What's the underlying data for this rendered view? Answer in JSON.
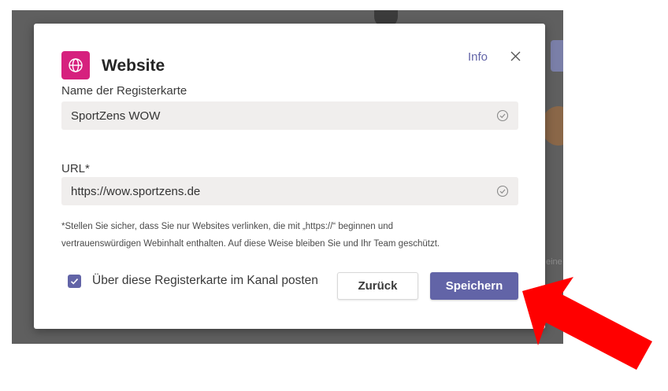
{
  "backdrop": {
    "partial_text": "eine"
  },
  "dialog": {
    "title": "Website",
    "app_icon": "globe-icon",
    "info_label": "Info",
    "close_icon": "close-icon"
  },
  "tab_name": {
    "label": "Name der Registerkarte",
    "value": "SportZens WOW"
  },
  "url": {
    "label": "URL*",
    "value": "https://wow.sportzens.de"
  },
  "hint": {
    "line1": "*Stellen Sie sicher, dass Sie nur Websites verlinken, die mit „https://“ beginnen und",
    "line2": "vertrauenswürdigen Webinhalt enthalten. Auf diese Weise bleiben Sie und Ihr Team geschützt."
  },
  "post_to_channel": {
    "label": "Über diese Registerkarte im Kanal posten",
    "checked": true
  },
  "buttons": {
    "back_label": "Zurück",
    "save_label": "Speichern"
  },
  "colors": {
    "accent": "#6264a7",
    "app_icon_bg": "#d6217e",
    "arrow": "#ff0000"
  }
}
